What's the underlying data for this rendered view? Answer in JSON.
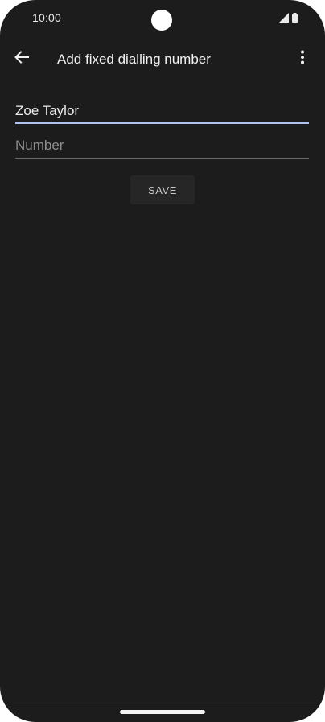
{
  "status_bar": {
    "time": "10:00",
    "icons": [
      "signal-icon",
      "battery-icon"
    ]
  },
  "app_bar": {
    "back_icon": "arrow-back-icon",
    "title": "Add fixed dialling number",
    "overflow_icon": "more-vert-icon"
  },
  "form": {
    "name_value": "Zoe Taylor",
    "number_value": "",
    "number_placeholder": "Number",
    "save_label": "SAVE"
  },
  "colors": {
    "background": "#1c1c1c",
    "accent_underline": "#aec3ee",
    "button_bg": "#262626"
  }
}
